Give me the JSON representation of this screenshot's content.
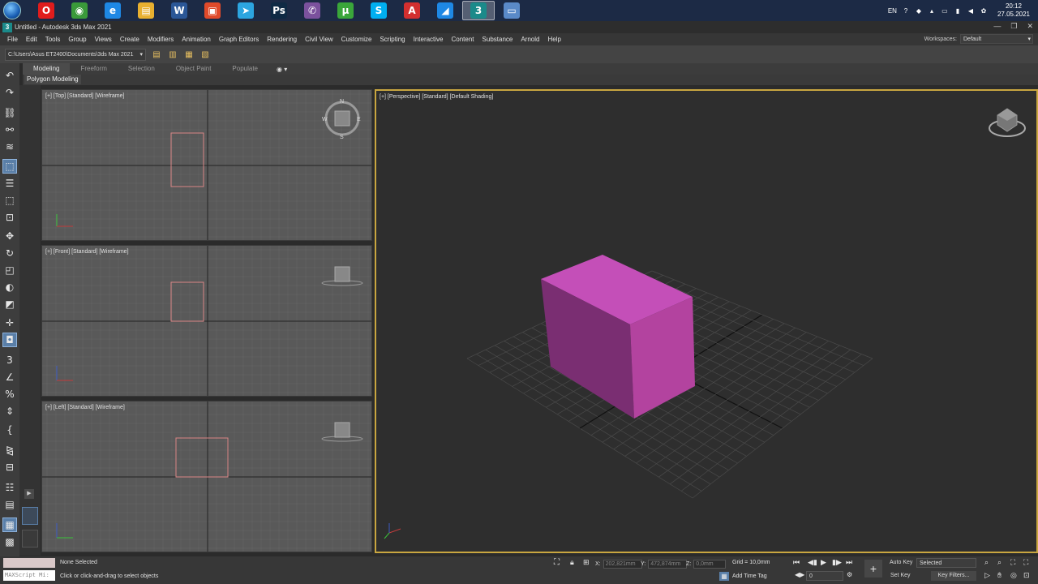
{
  "taskbar": {
    "apps": [
      {
        "icon": "opera-icon",
        "glyph": "O",
        "color": "#e01c1c"
      },
      {
        "icon": "chrome-icon",
        "glyph": "◉",
        "color": "#3a9a3a"
      },
      {
        "icon": "ie-icon",
        "glyph": "e",
        "color": "#1e88e5"
      },
      {
        "icon": "explorer-icon",
        "glyph": "▤",
        "color": "#e8b030"
      },
      {
        "icon": "word-icon",
        "glyph": "W",
        "color": "#2b5797"
      },
      {
        "icon": "pdf-icon",
        "glyph": "▣",
        "color": "#e04a2a"
      },
      {
        "icon": "telegram-icon",
        "glyph": "➤",
        "color": "#2ca5e0"
      },
      {
        "icon": "photoshop-icon",
        "glyph": "Ps",
        "color": "#0f2a44"
      },
      {
        "icon": "viber-icon",
        "glyph": "✆",
        "color": "#7b519d"
      },
      {
        "icon": "utorrent-icon",
        "glyph": "μ",
        "color": "#3aa63a"
      },
      {
        "icon": "skype-icon",
        "glyph": "S",
        "color": "#00aff0"
      },
      {
        "icon": "autocad-icon",
        "glyph": "A",
        "color": "#d32f2f"
      },
      {
        "icon": "sketchbook-icon",
        "glyph": "◢",
        "color": "#1e88e5"
      },
      {
        "icon": "3dsmax-icon",
        "glyph": "3",
        "color": "#1b8a8a"
      },
      {
        "icon": "remote-desktop-icon",
        "glyph": "▭",
        "color": "#5a8ac8"
      }
    ],
    "tray": {
      "language": "EN",
      "time": "20:12",
      "date": "27.05.2021"
    }
  },
  "window": {
    "title": "Untitled - Autodesk 3ds Max 2021",
    "logo": "3"
  },
  "menubar": {
    "items": [
      "File",
      "Edit",
      "Tools",
      "Group",
      "Views",
      "Create",
      "Modifiers",
      "Animation",
      "Graph Editors",
      "Rendering",
      "Civil View",
      "Customize",
      "Scripting",
      "Interactive",
      "Content",
      "Substance",
      "Arnold",
      "Help"
    ],
    "workspaces_label": "Workspaces:",
    "workspaces_value": "Default"
  },
  "toolbar": {
    "project_path": "C:\\Users\\Asus ET2400\\Documents\\3ds Max 2021"
  },
  "ribbon": {
    "tabs": [
      "Modeling",
      "Freeform",
      "Selection",
      "Object Paint",
      "Populate"
    ],
    "active_tab": "Modeling",
    "panel_label": "Polygon Modeling"
  },
  "viewports": {
    "top_label": "[+] [Top] [Standard] [Wireframe]",
    "front_label": "[+] [Front] [Standard] [Wireframe]",
    "left_label": "[+] [Left] [Standard] [Wireframe]",
    "persp_label": "[+] [Perspective] [Standard] [Default Shading]",
    "box_color": "#c44fb8",
    "wire_color": "#d98585",
    "compass": [
      "N",
      "S",
      "W",
      "E"
    ]
  },
  "statusbar": {
    "maxscript": "MAXScript Mi:",
    "selection": "None Selected",
    "prompt": "Click or click-and-drag to select objects",
    "x_label": "X:",
    "x_value": "202,821mm",
    "y_label": "Y:",
    "y_value": "472,874mm",
    "z_label": "Z:",
    "z_value": "0,0mm",
    "grid": "Grid = 10,0mm",
    "add_time_tag": "Add Time Tag",
    "auto_key": "Auto Key",
    "set_key": "Set Key",
    "selected": "Selected",
    "key_filters": "Key Filters...",
    "frame": "0"
  }
}
